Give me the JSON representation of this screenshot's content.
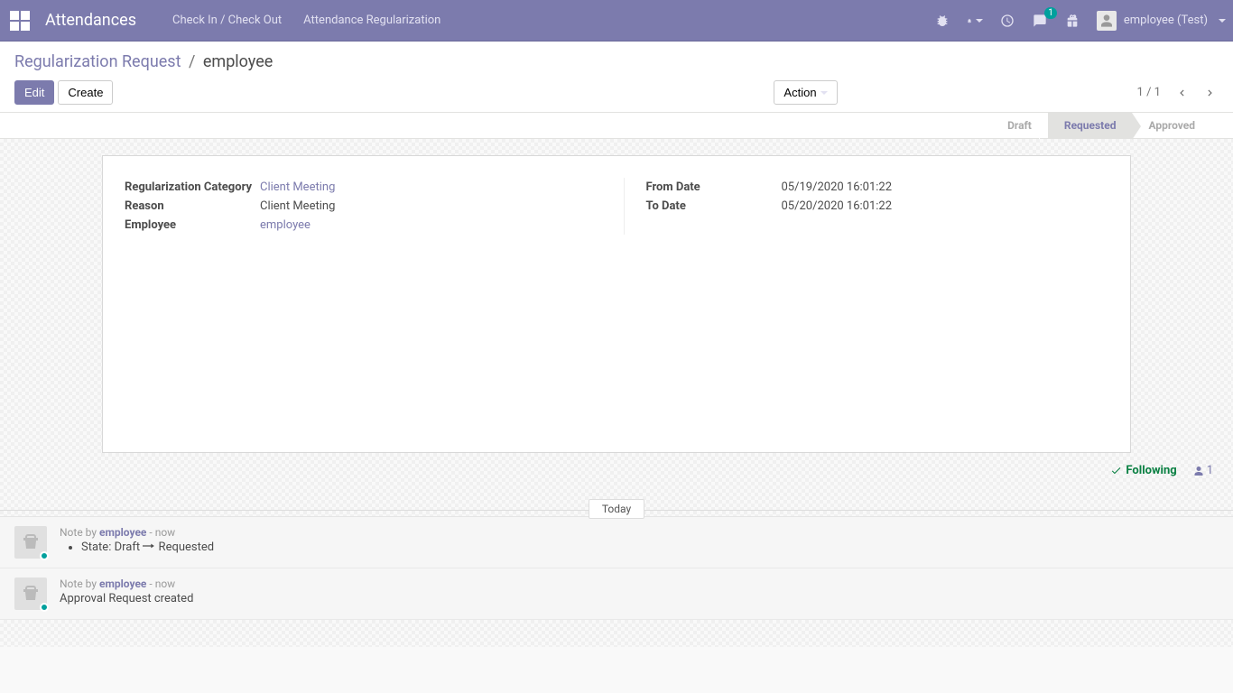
{
  "navbar": {
    "brand": "Attendances",
    "links": [
      "Check In / Check Out",
      "Attendance Regularization"
    ],
    "messaging_count": "1",
    "user_label": "employee (Test)"
  },
  "breadcrumb": {
    "parent": "Regularization Request",
    "current": "employee"
  },
  "buttons": {
    "edit": "Edit",
    "create": "Create",
    "action": "Action"
  },
  "pager": {
    "text": "1 / 1"
  },
  "status": {
    "steps": [
      "Draft",
      "Requested",
      "Approved"
    ],
    "active_index": 1
  },
  "form": {
    "left": [
      {
        "label": "Regularization Category",
        "value": "Client Meeting",
        "link": true
      },
      {
        "label": "Reason",
        "value": "Client Meeting",
        "link": false
      },
      {
        "label": "Employee",
        "value": "employee",
        "link": true
      }
    ],
    "right": [
      {
        "label": "From Date",
        "value": "05/19/2020 16:01:22"
      },
      {
        "label": "To Date",
        "value": "05/20/2020 16:01:22"
      }
    ]
  },
  "followers": {
    "following_label": "Following",
    "count": "1"
  },
  "thread": {
    "sep_label": "Today",
    "messages": [
      {
        "note_prefix": "Note by ",
        "author": "employee",
        "time": " - now",
        "type": "state",
        "state_from": "State: Draft ",
        "state_to": " Requested"
      },
      {
        "note_prefix": "Note by ",
        "author": "employee",
        "time": " - now",
        "type": "text",
        "text": "Approval Request created"
      }
    ]
  }
}
